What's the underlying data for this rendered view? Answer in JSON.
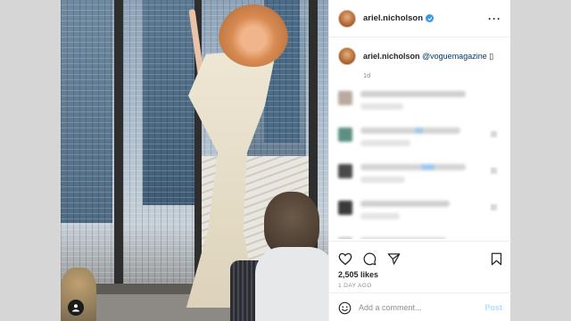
{
  "post": {
    "username": "ariel.nicholson",
    "caption_username": "ariel.nicholson",
    "caption_mention": "@voguemagazine",
    "caption_suffix": "▯",
    "time_ago": "1d",
    "likes": "2,505 likes",
    "date": "1 DAY AGO"
  },
  "comment_box": {
    "placeholder": "Add a comment...",
    "post_label": "Post"
  },
  "icons": {
    "verified": "verified-badge-icon",
    "more": "more-options-icon",
    "like": "heart-icon",
    "comment": "comment-icon",
    "share": "share-icon",
    "save": "bookmark-icon",
    "emoji": "emoji-icon",
    "user_tag": "user-tag-icon"
  },
  "colors": {
    "verified": "#3897f0",
    "mention": "#00376b",
    "muted": "#8e8e8e",
    "post_disabled": "#b2dffc"
  }
}
